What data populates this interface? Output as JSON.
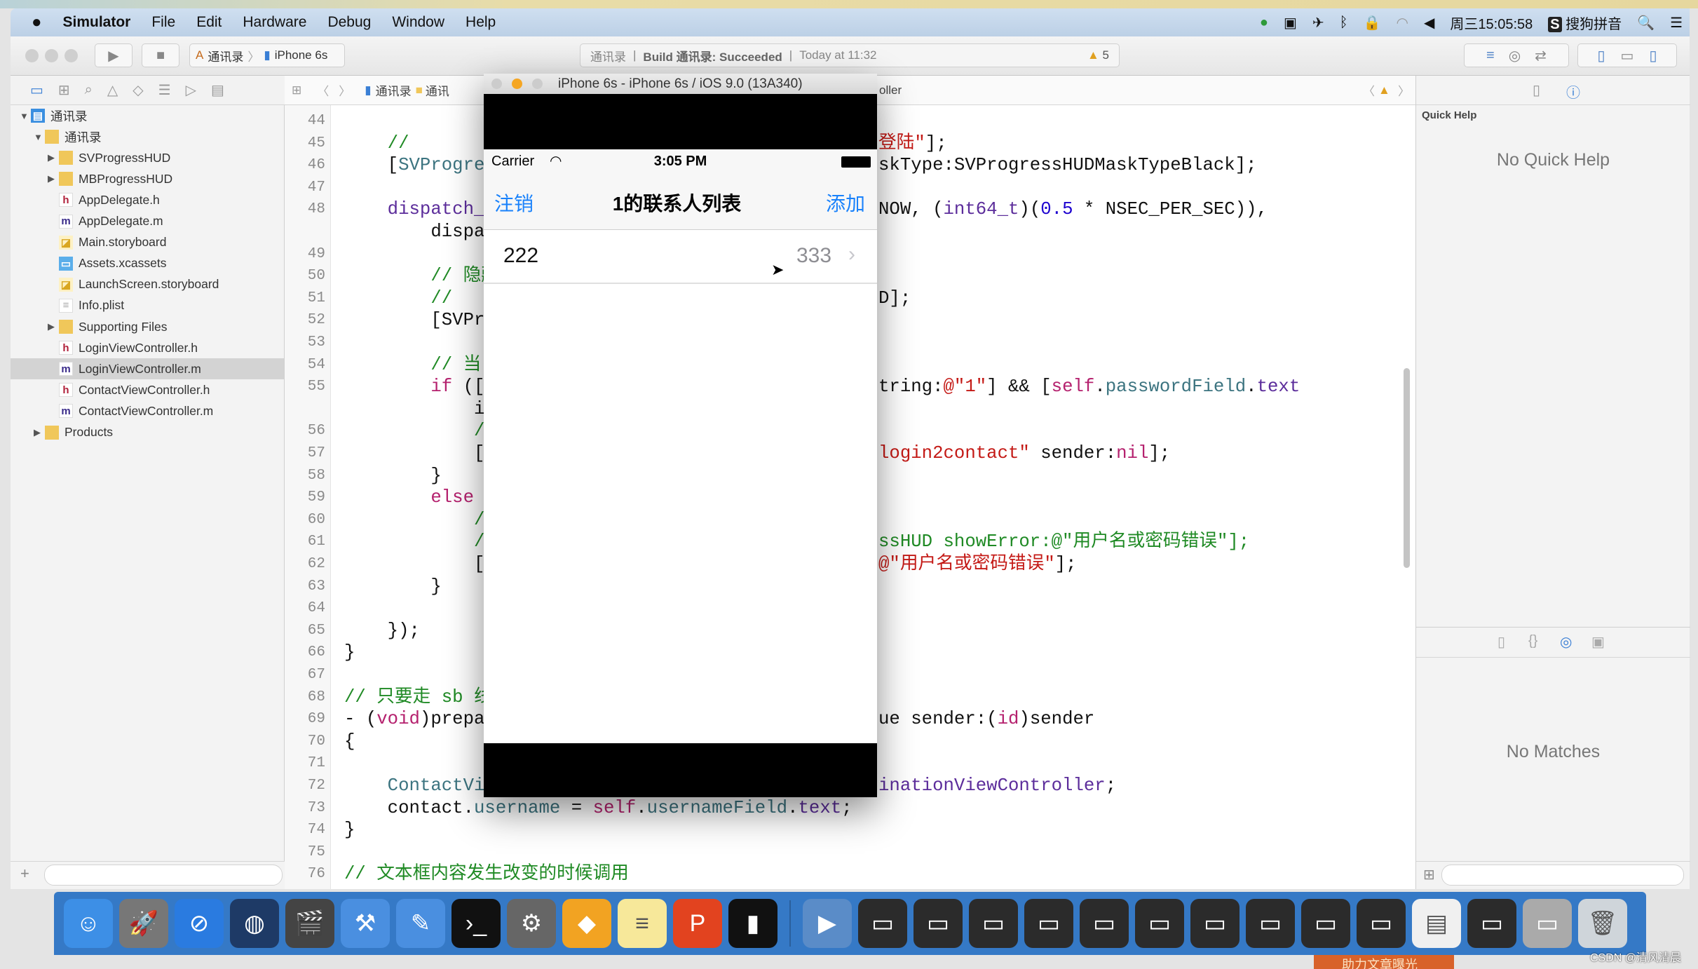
{
  "menubar": {
    "app": "Simulator",
    "items": [
      "File",
      "Edit",
      "Hardware",
      "Debug",
      "Window",
      "Help"
    ],
    "clock": "周三15:05:58",
    "input_method": "搜狗拼音"
  },
  "toolbar": {
    "scheme": "通讯录",
    "device": "iPhone 6s",
    "activity_project": "通讯录",
    "activity_build": "Build 通讯录: Succeeded",
    "activity_time": "Today at 11:32",
    "warning_count": "5"
  },
  "jumpbar": {
    "project": "通讯录",
    "folder": "通讯",
    "file_suffix": "oller"
  },
  "navigator": {
    "items": [
      {
        "label": "通讯录",
        "level": 0,
        "icon": "project-icon",
        "arrow": "▼"
      },
      {
        "label": "通讯录",
        "level": 1,
        "icon": "folder-icon",
        "arrow": "▼"
      },
      {
        "label": "SVProgressHUD",
        "level": 2,
        "icon": "folder-icon",
        "arrow": "▶"
      },
      {
        "label": "MBProgressHUD",
        "level": 2,
        "icon": "folder-icon",
        "arrow": "▶"
      },
      {
        "label": "AppDelegate.h",
        "level": 2,
        "icon": "header-file-icon",
        "arrow": ""
      },
      {
        "label": "AppDelegate.m",
        "level": 2,
        "icon": "source-file-icon",
        "arrow": ""
      },
      {
        "label": "Main.storyboard",
        "level": 2,
        "icon": "storyboard-icon",
        "arrow": ""
      },
      {
        "label": "Assets.xcassets",
        "level": 2,
        "icon": "assets-icon",
        "arrow": ""
      },
      {
        "label": "LaunchScreen.storyboard",
        "level": 2,
        "icon": "storyboard-icon",
        "arrow": ""
      },
      {
        "label": "Info.plist",
        "level": 2,
        "icon": "plist-icon",
        "arrow": ""
      },
      {
        "label": "Supporting Files",
        "level": 2,
        "icon": "folder-icon",
        "arrow": "▶"
      },
      {
        "label": "LoginViewController.h",
        "level": 2,
        "icon": "header-file-icon",
        "arrow": ""
      },
      {
        "label": "LoginViewController.m",
        "level": 2,
        "icon": "source-file-icon",
        "arrow": "",
        "selected": true
      },
      {
        "label": "ContactViewController.h",
        "level": 2,
        "icon": "header-file-icon",
        "arrow": ""
      },
      {
        "label": "ContactViewController.m",
        "level": 2,
        "icon": "source-file-icon",
        "arrow": ""
      },
      {
        "label": "Products",
        "level": 1,
        "icon": "folder-icon",
        "arrow": "▶"
      }
    ]
  },
  "code": {
    "rows": [
      {
        "n": "44",
        "l": [],
        "r": []
      },
      {
        "n": "45",
        "l": [
          [
            "    //",
            "c"
          ]
        ],
        "r": [
          [
            "登陆\"",
            "s"
          ],
          [
            "];",
            "x"
          ]
        ]
      },
      {
        "n": "46",
        "l": [
          [
            "    [",
            "x"
          ],
          [
            "SVProgressHUD",
            "p"
          ]
        ],
        "r": [
          [
            "skType:SVProgressHUDMaskTypeBlack];",
            "x"
          ]
        ]
      },
      {
        "n": "47",
        "l": [],
        "r": []
      },
      {
        "n": "48",
        "l": [
          [
            "    dispatch_after",
            "m"
          ]
        ],
        "r": [
          [
            "NOW, (",
            "x"
          ],
          [
            "int64_t",
            "m"
          ],
          [
            ")(",
            "x"
          ],
          [
            "0.5",
            "n"
          ],
          [
            " * NSEC_PER_SEC)),",
            "x"
          ]
        ]
      },
      {
        "n": "",
        "l": [
          [
            "        dispatch",
            "x"
          ]
        ],
        "r": []
      },
      {
        "n": "49",
        "l": [],
        "r": []
      },
      {
        "n": "50",
        "l": [
          [
            "        // 隐藏",
            "c"
          ]
        ],
        "r": []
      },
      {
        "n": "51",
        "l": [
          [
            "        //",
            "c"
          ]
        ],
        "r": [
          [
            "D];",
            "x"
          ]
        ]
      },
      {
        "n": "52",
        "l": [
          [
            "        [SVProgress",
            "x"
          ]
        ],
        "r": []
      },
      {
        "n": "53",
        "l": [],
        "r": []
      },
      {
        "n": "54",
        "l": [
          [
            "        // 当",
            "c"
          ]
        ],
        "r": []
      },
      {
        "n": "55",
        "l": [
          [
            "        if",
            "k"
          ],
          [
            " ([",
            "x"
          ]
        ],
        "r": [
          [
            "tring:",
            "x"
          ],
          [
            "@\"1\"",
            "s"
          ],
          [
            "] && [",
            "x"
          ],
          [
            "self",
            "k"
          ],
          [
            ".",
            "x"
          ],
          [
            "passwordField",
            "p"
          ],
          [
            ".",
            "x"
          ],
          [
            "text",
            "m"
          ]
        ]
      },
      {
        "n": "",
        "l": [
          [
            "            i",
            "x"
          ]
        ],
        "r": []
      },
      {
        "n": "56",
        "l": [
          [
            "            //",
            "c"
          ]
        ],
        "r": []
      },
      {
        "n": "57",
        "l": [
          [
            "            [",
            "x"
          ]
        ],
        "r": [
          [
            "login2contact\"",
            "s"
          ],
          [
            " sender:",
            "x"
          ],
          [
            "nil",
            "k"
          ],
          [
            "];",
            "x"
          ]
        ]
      },
      {
        "n": "58",
        "l": [
          [
            "        }",
            "x"
          ]
        ],
        "r": []
      },
      {
        "n": "59",
        "l": [
          [
            "        else",
            "k"
          ]
        ],
        "r": []
      },
      {
        "n": "60",
        "l": [
          [
            "            //",
            "c"
          ]
        ],
        "r": []
      },
      {
        "n": "61",
        "l": [
          [
            "            //",
            "c"
          ]
        ],
        "r": [
          [
            "ssHUD showError:",
            "c"
          ],
          [
            "@\"用户名或密码错误\"",
            "c"
          ],
          [
            "];",
            "c"
          ]
        ]
      },
      {
        "n": "62",
        "l": [
          [
            "            [",
            "x"
          ]
        ],
        "r": [
          [
            "@\"用户名或密码错误\"",
            "s"
          ],
          [
            "];",
            "x"
          ]
        ]
      },
      {
        "n": "63",
        "l": [
          [
            "        }",
            "x"
          ]
        ],
        "r": []
      },
      {
        "n": "64",
        "l": [],
        "r": []
      },
      {
        "n": "65",
        "l": [
          [
            "    });",
            "x"
          ]
        ],
        "r": []
      },
      {
        "n": "66",
        "l": [
          [
            "}",
            "x"
          ]
        ],
        "r": []
      },
      {
        "n": "67",
        "l": [],
        "r": []
      },
      {
        "n": "68",
        "l": [
          [
            "// 只要走 sb 线",
            "c"
          ]
        ],
        "r": []
      },
      {
        "n": "69",
        "l": [
          [
            "- (",
            "x"
          ],
          [
            "void",
            "k"
          ],
          [
            ")prepareForSegue",
            "x"
          ]
        ],
        "r": [
          [
            "ue sender:(",
            "x"
          ],
          [
            "id",
            "k"
          ],
          [
            ")sender",
            "x"
          ]
        ]
      },
      {
        "n": "70",
        "l": [
          [
            "{",
            "x"
          ]
        ],
        "r": []
      },
      {
        "n": "71",
        "l": [],
        "r": []
      },
      {
        "n": "72",
        "l": [
          [
            "    ContactViewController",
            "p"
          ]
        ],
        "r": [
          [
            "inationViewController",
            "m"
          ],
          [
            ";",
            "x"
          ]
        ]
      },
      {
        "n": "73",
        "l": [
          [
            "    contact.",
            "x"
          ],
          [
            "username",
            "p"
          ],
          [
            " = ",
            "x"
          ],
          [
            "self",
            "k"
          ],
          [
            ".",
            "x"
          ],
          [
            "usernameField",
            "p"
          ],
          [
            ".",
            "x"
          ],
          [
            "text",
            "m"
          ],
          [
            ";",
            "x"
          ]
        ],
        "r": []
      },
      {
        "n": "74",
        "l": [
          [
            "}",
            "x"
          ]
        ],
        "r": []
      },
      {
        "n": "75",
        "l": [],
        "r": []
      },
      {
        "n": "76",
        "l": [
          [
            "// 文本框内容发生改变的时候调用",
            "c"
          ]
        ],
        "r": []
      }
    ]
  },
  "simulator": {
    "title": "iPhone 6s - iPhone 6s / iOS 9.0 (13A340)",
    "carrier": "Carrier",
    "time": "3:05 PM",
    "nav_left": "注销",
    "nav_title": "1的联系人列表",
    "nav_right": "添加",
    "cell_title": "222",
    "cell_detail": "333",
    "tint": "#1a82fb"
  },
  "inspector": {
    "title": "Quick Help",
    "quick_help": "No Quick Help",
    "library": "No Matches"
  },
  "dock": {
    "apps": [
      [
        "finder-icon",
        "#3d8fe6",
        "☺"
      ],
      [
        "launchpad-icon",
        "#777",
        "🚀"
      ],
      [
        "safari-icon",
        "#2a7be0",
        "⊘"
      ],
      [
        "mouse-app-icon",
        "#1e3a66",
        "◍"
      ],
      [
        "video-editor-icon",
        "#444",
        "🎬"
      ],
      [
        "xcode-icon",
        "#4a8fe0",
        "⚒"
      ],
      [
        "instruments-icon",
        "#4a8fe0",
        "✎"
      ],
      [
        "terminal-icon",
        "#111",
        "›_"
      ],
      [
        "system-preferences-icon",
        "#666",
        "⚙"
      ],
      [
        "sketch-icon",
        "#f2a322",
        "◆"
      ],
      [
        "notes-icon",
        "#f7e89a",
        "≡"
      ],
      [
        "wps-icon",
        "#e2431f",
        "P"
      ],
      [
        "console-icon",
        "#111",
        "▮"
      ],
      [
        "quicktime-icon",
        "#5a8cc8",
        "▶"
      ],
      [
        "window-icon",
        "#2b2b2b",
        "▭"
      ],
      [
        "window-icon",
        "#2b2b2b",
        "▭"
      ],
      [
        "window-icon",
        "#2b2b2b",
        "▭"
      ],
      [
        "window-icon",
        "#2b2b2b",
        "▭"
      ],
      [
        "window-icon",
        "#2b2b2b",
        "▭"
      ],
      [
        "window-icon",
        "#2b2b2b",
        "▭"
      ],
      [
        "window-icon",
        "#2b2b2b",
        "▭"
      ],
      [
        "window-icon",
        "#2b2b2b",
        "▭"
      ],
      [
        "window-icon",
        "#2b2b2b",
        "▭"
      ],
      [
        "window-icon",
        "#2b2b2b",
        "▭"
      ],
      [
        "document-icon",
        "#f0f0f0",
        "▤"
      ],
      [
        "window-icon",
        "#2b2b2b",
        "▭"
      ],
      [
        "window-icon",
        "#aaa",
        "▭"
      ],
      [
        "trash-icon",
        "#cfd5da",
        "🗑"
      ]
    ]
  },
  "watermark": "CSDN @清风清晨",
  "banner": "助力文章曝光"
}
